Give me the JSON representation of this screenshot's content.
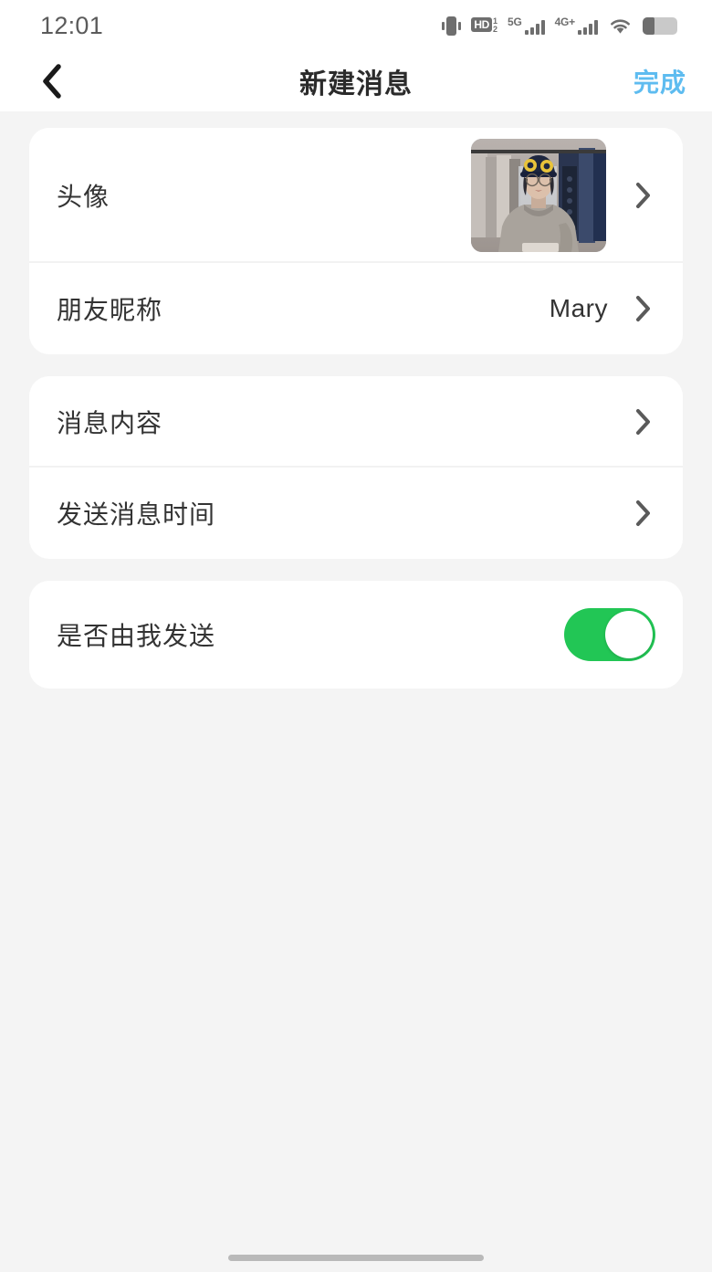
{
  "status_bar": {
    "time": "12:01",
    "icons": [
      {
        "name": "vibrate-icon",
        "label": ""
      },
      {
        "name": "hd-voice-icon",
        "label": "HD",
        "sup": "1",
        "sub": "2"
      },
      {
        "name": "signal-5g-icon",
        "label": "5G",
        "bars": 4
      },
      {
        "name": "signal-4g-plus-icon",
        "label": "4G+",
        "bars": 4
      },
      {
        "name": "wifi-icon",
        "label": ""
      },
      {
        "name": "battery-icon",
        "label": ""
      }
    ]
  },
  "nav_bar": {
    "back_label": "‹",
    "title": "新建消息",
    "done_label": "完成",
    "done_color": "#5ebcf0"
  },
  "cards": [
    {
      "name": "profile-card",
      "rows": [
        {
          "name": "avatar-row",
          "label": "头像",
          "value": "",
          "type": "avatar",
          "chevron": "›"
        },
        {
          "name": "nickname-row",
          "label": "朋友昵称",
          "value": "Mary",
          "type": "value",
          "chevron": "›"
        }
      ]
    },
    {
      "name": "message-card",
      "rows": [
        {
          "name": "message-content-row",
          "label": "消息内容",
          "value": "",
          "type": "link",
          "chevron": "›"
        },
        {
          "name": "send-time-row",
          "label": "发送消息时间",
          "value": "",
          "type": "link",
          "chevron": "›"
        }
      ]
    },
    {
      "name": "sender-card",
      "rows": [
        {
          "name": "sent-by-me-row",
          "label": "是否由我发送",
          "value": "",
          "type": "toggle",
          "toggle_on": true,
          "toggle_color": "#22c655"
        }
      ]
    }
  ],
  "theme": {
    "background": "#f4f4f4",
    "card_background": "#ffffff",
    "text_primary": "#333333",
    "accent": "#5ebcf0",
    "toggle_on": "#22c655"
  }
}
